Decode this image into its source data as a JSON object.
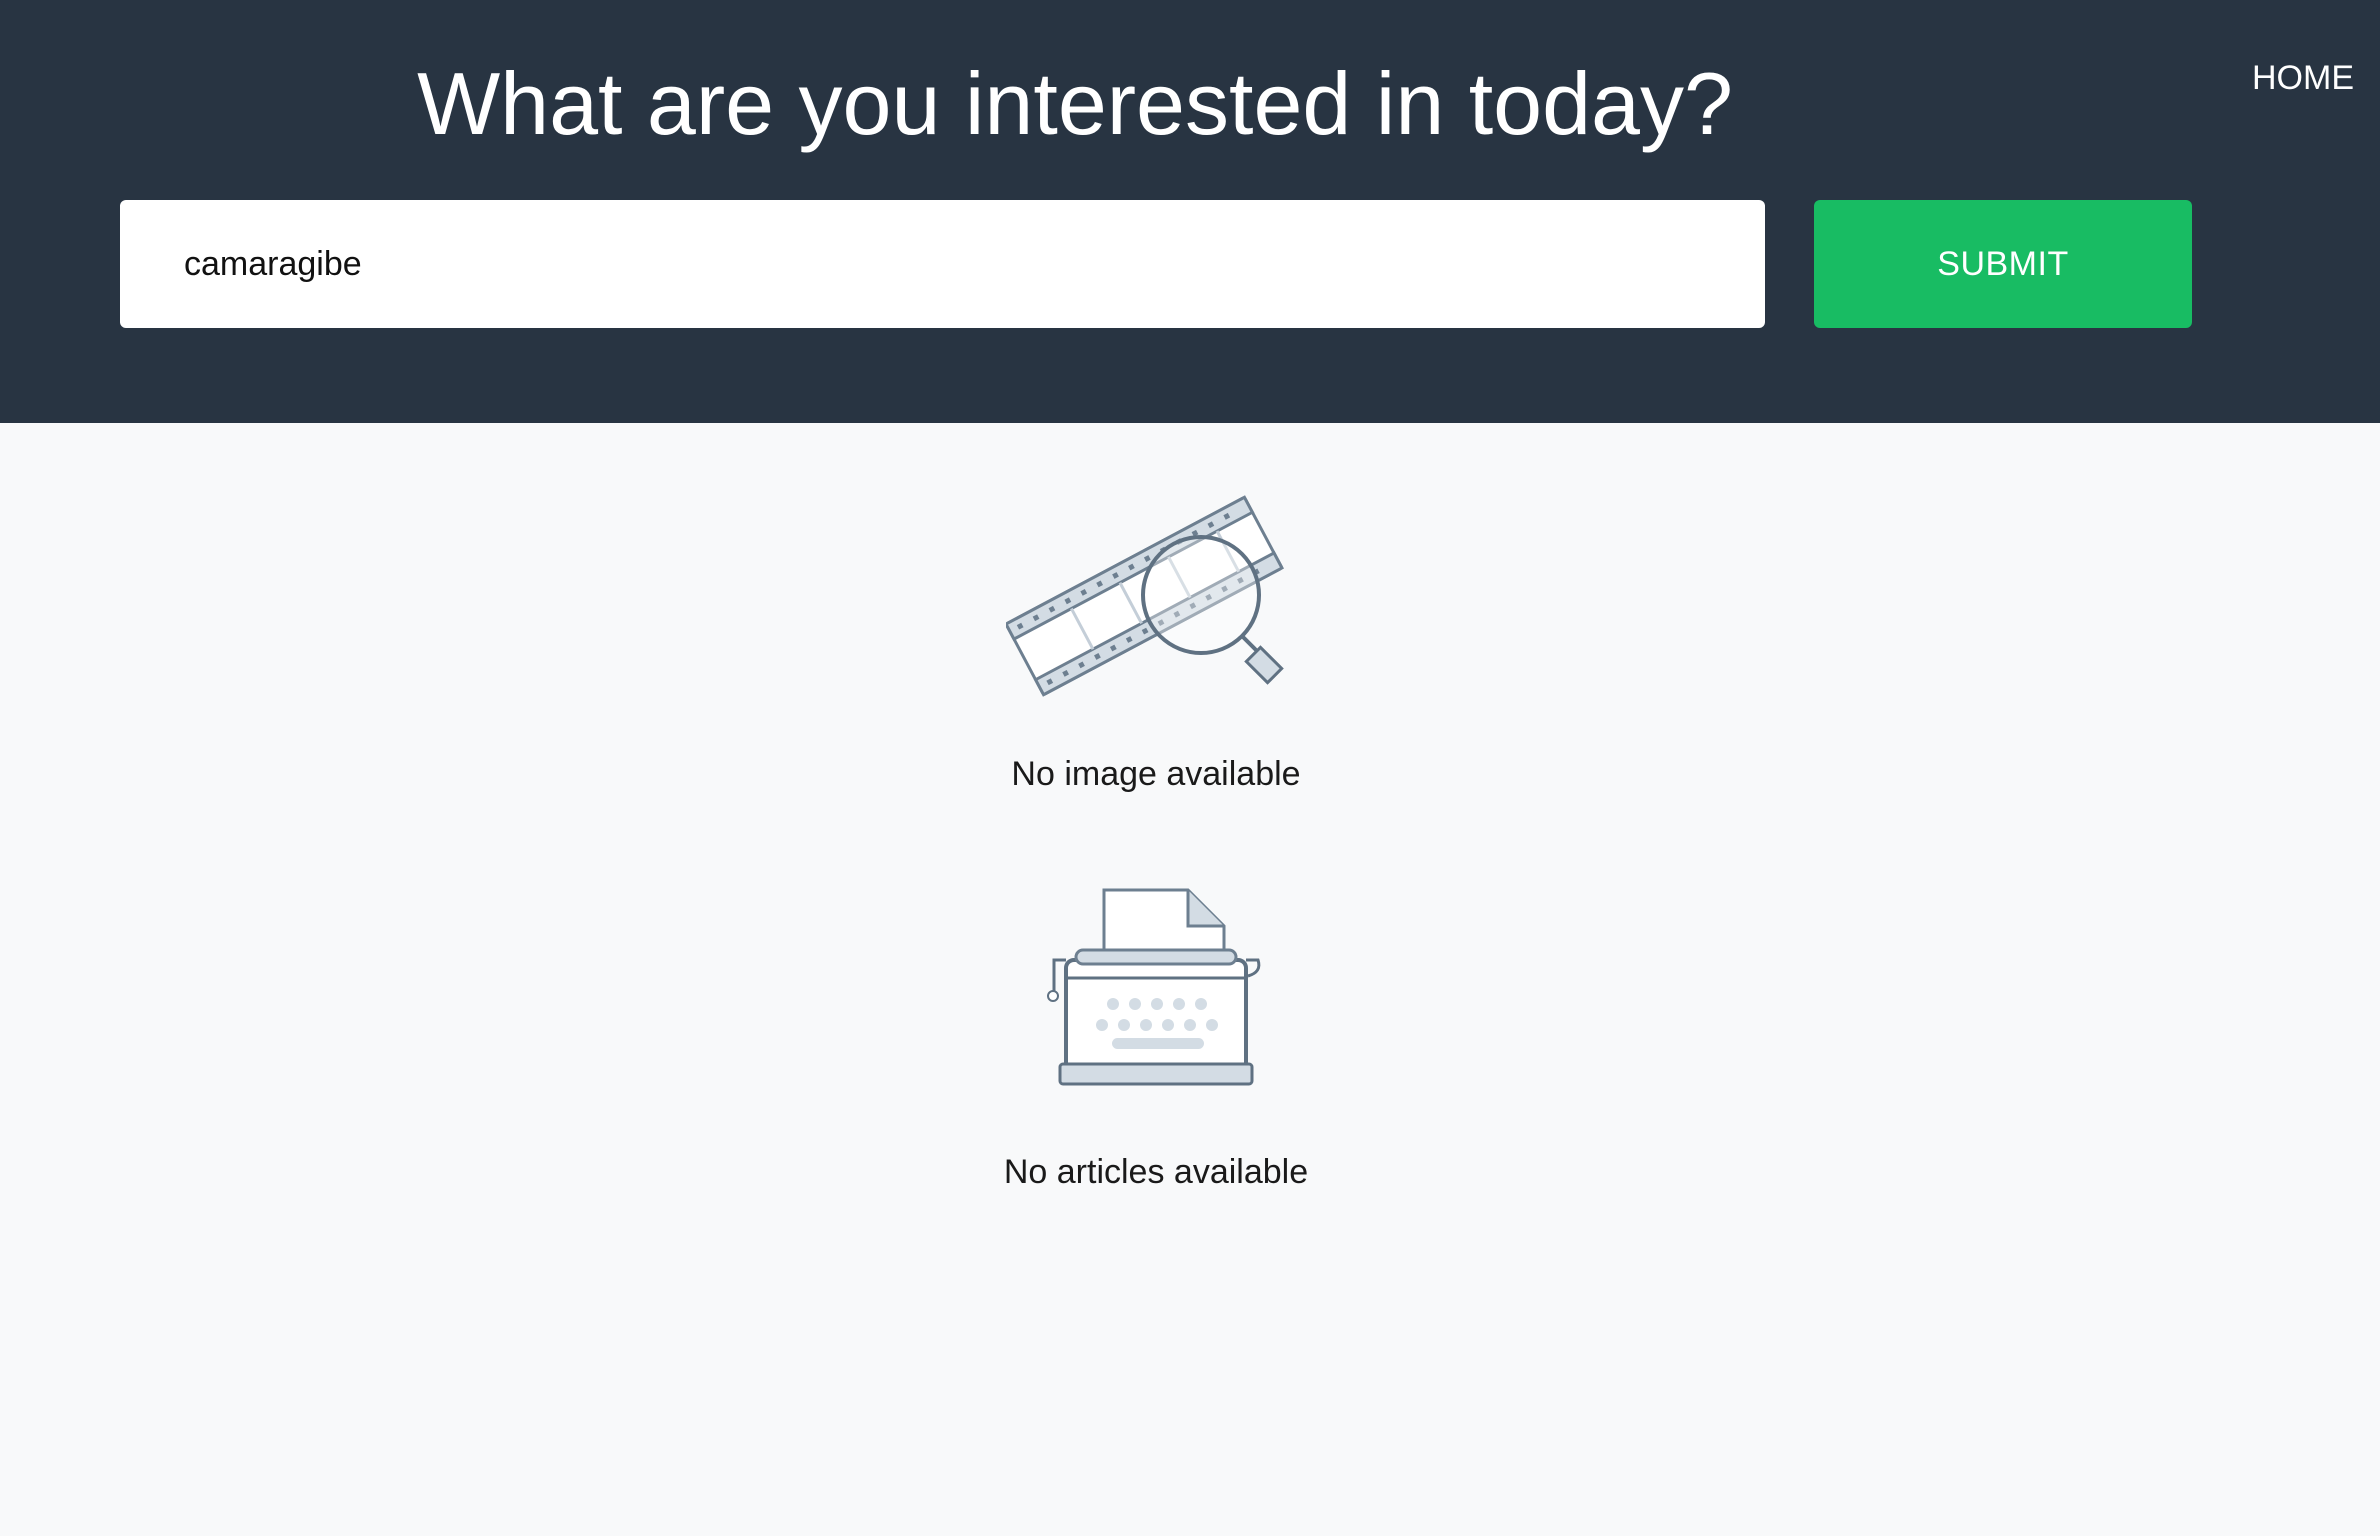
{
  "header": {
    "title": "What are you interested in today?",
    "home_label": "HOME"
  },
  "search": {
    "value": "camaragibe",
    "submit_label": "SUBMIT"
  },
  "results": {
    "images_empty": "No image available",
    "images_icon": "film-strip-magnifier-icon",
    "articles_empty": "No articles available",
    "articles_icon": "typewriter-icon"
  },
  "colors": {
    "header_bg": "#283442",
    "page_bg": "#f8f9fa",
    "submit_bg": "#18bc63",
    "icon_stroke": "#5f7182",
    "icon_fill": "#d3dce4"
  }
}
